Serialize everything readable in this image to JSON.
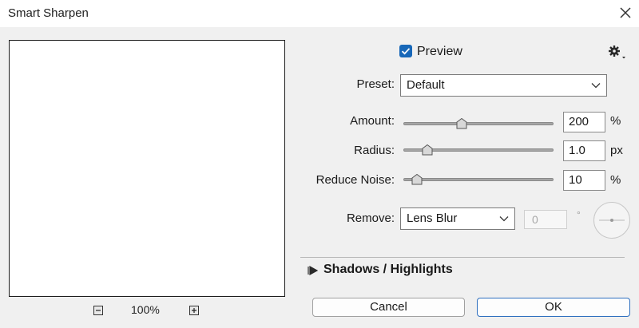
{
  "window": {
    "title": "Smart Sharpen"
  },
  "preview": {
    "label": "Preview",
    "checked": true
  },
  "zoom": {
    "level": "100%"
  },
  "preset": {
    "label": "Preset:",
    "value": "Default"
  },
  "amount": {
    "label": "Amount:",
    "value": "200",
    "unit": "%",
    "slider_fraction": 0.39
  },
  "radius": {
    "label": "Radius:",
    "value": "1.0",
    "unit": "px",
    "slider_fraction": 0.16
  },
  "reduce_noise": {
    "label": "Reduce Noise:",
    "value": "10",
    "unit": "%",
    "slider_fraction": 0.09
  },
  "remove": {
    "label": "Remove:",
    "value": "Lens Blur",
    "angle_value": "0",
    "angle_unit": "°"
  },
  "shadows_highlights": {
    "label": "Shadows / Highlights",
    "expanded": false
  },
  "buttons": {
    "cancel": "Cancel",
    "ok": "OK"
  },
  "icons": {
    "close": "close-icon",
    "gear": "gear-icon",
    "zoom_out": "minus-icon",
    "zoom_in": "plus-icon",
    "expand": "triangle-right-icon",
    "dropdown": "chevron-down-icon"
  },
  "colors": {
    "accent": "#1767b8",
    "ok_border": "#2e6fbf"
  }
}
